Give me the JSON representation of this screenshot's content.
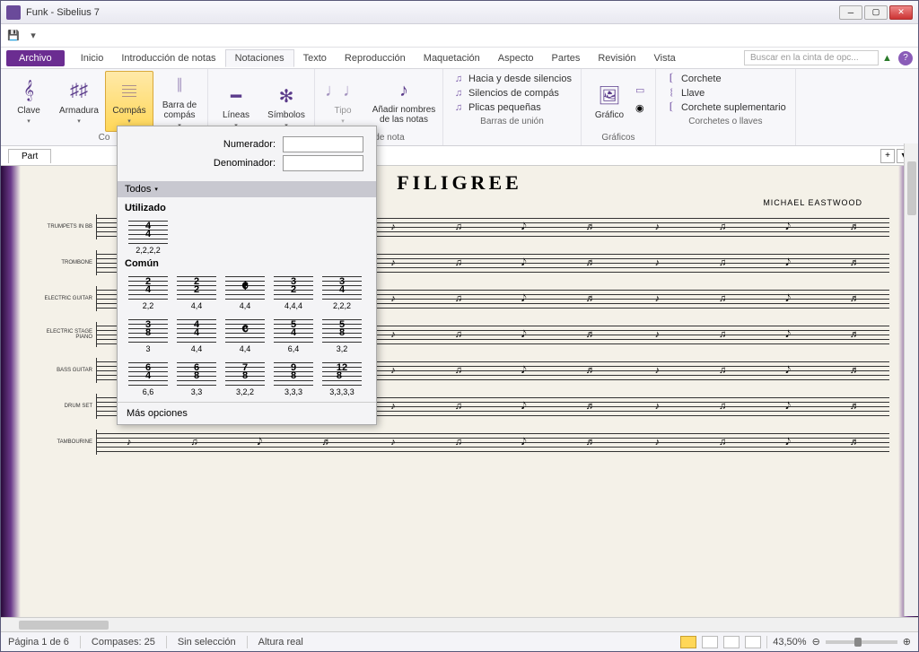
{
  "window": {
    "title": "Funk - Sibelius 7"
  },
  "tabs": {
    "file": "Archivo",
    "items": [
      "Inicio",
      "Introducción de notas",
      "Notaciones",
      "Texto",
      "Reproducción",
      "Maquetación",
      "Aspecto",
      "Partes",
      "Revisión",
      "Vista"
    ],
    "active": "Notaciones",
    "search_placeholder": "Buscar en la cinta de opc..."
  },
  "ribbon": {
    "g1": {
      "clave": "Clave",
      "armadura": "Armadura",
      "compas": "Compás",
      "barra": "Barra de compás"
    },
    "g2": {
      "lineas": "Líneas",
      "simbolos": "Símbolos"
    },
    "g3": {
      "tipo": "Tipo",
      "anadir": "Añadir nombres de las notas",
      "label": "ezas de nota"
    },
    "g4": {
      "a": "Hacia y desde silencios",
      "b": "Silencios de compás",
      "c": "Plicas pequeñas",
      "label": "Barras de unión"
    },
    "g5": {
      "grafico": "Gráfico",
      "label": "Gráficos"
    },
    "g6": {
      "a": "Corchete",
      "b": "Llave",
      "c": "Corchete suplementario",
      "label": "Corchetes o llaves"
    }
  },
  "doctab": "Part",
  "popup": {
    "num_label": "Numerador:",
    "den_label": "Denominador:",
    "todos": "Todos",
    "utilizado": "Utilizado",
    "comun": "Común",
    "mas": "Más opciones",
    "used": [
      {
        "n": "4",
        "d": "4",
        "l": "2,2,2,2"
      }
    ],
    "common": [
      {
        "n": "2",
        "d": "4",
        "l": "2,2"
      },
      {
        "n": "2",
        "d": "2",
        "l": "4,4"
      },
      {
        "sym": "𝄵",
        "l": "4,4"
      },
      {
        "n": "3",
        "d": "2",
        "l": "4,4,4"
      },
      {
        "n": "3",
        "d": "4",
        "l": "2,2,2"
      },
      {
        "n": "3",
        "d": "8",
        "l": "3"
      },
      {
        "n": "4",
        "d": "4",
        "l": "4,4"
      },
      {
        "sym": "𝄴",
        "l": "4,4"
      },
      {
        "n": "5",
        "d": "4",
        "l": "6,4"
      },
      {
        "n": "5",
        "d": "8",
        "l": "3,2"
      },
      {
        "n": "6",
        "d": "4",
        "l": "6,6"
      },
      {
        "n": "6",
        "d": "8",
        "l": "3,3"
      },
      {
        "n": "7",
        "d": "8",
        "l": "3,2,2"
      },
      {
        "n": "9",
        "d": "8",
        "l": "3,3,3"
      },
      {
        "n": "12",
        "d": "8",
        "l": "3,3,3,3"
      }
    ]
  },
  "score": {
    "title": "FILIGREE",
    "composer": "MICHAEL EASTWOOD",
    "staves": [
      "Trumpets in Bb",
      "Trombone",
      "Electric Guitar",
      "Electric Stage Piano",
      "Bass Guitar",
      "Drum Set",
      "Tambourine"
    ]
  },
  "status": {
    "page": "Página 1 de 6",
    "compases": "Compases: 25",
    "sel": "Sin selección",
    "altura": "Altura real",
    "zoom": "43,50%"
  }
}
